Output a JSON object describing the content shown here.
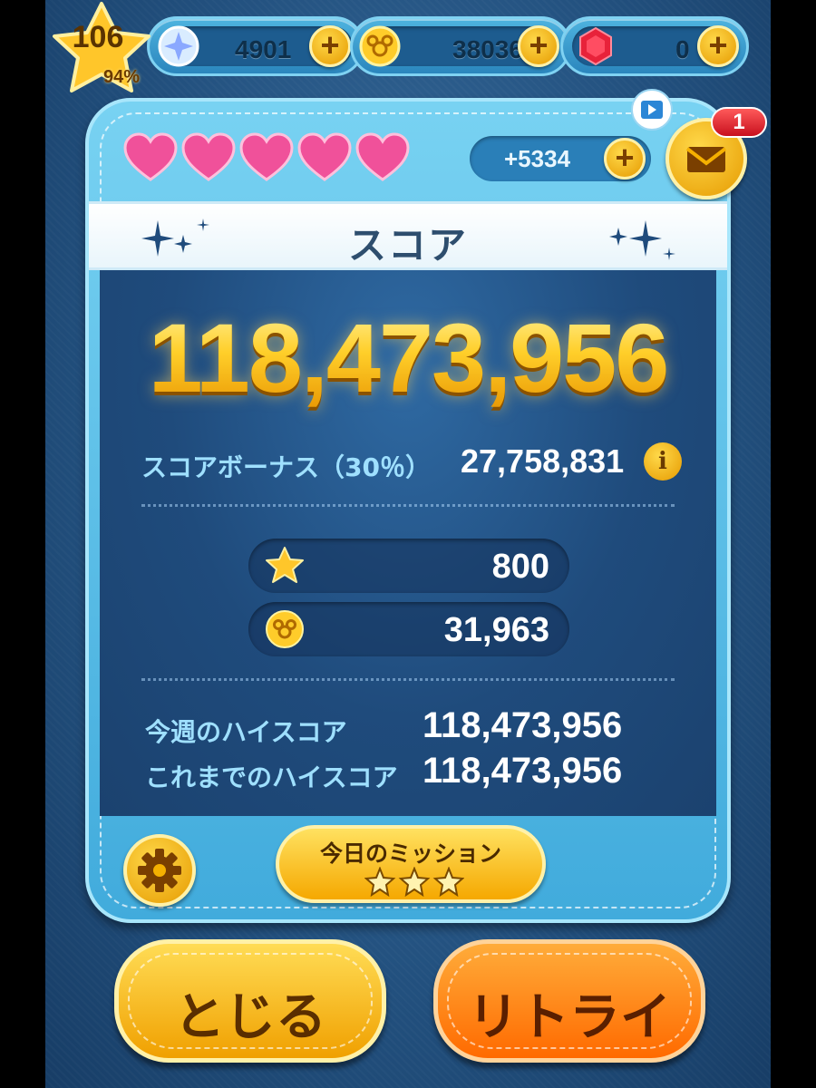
{
  "player": {
    "level": "106",
    "level_progress": "94%"
  },
  "resources": {
    "gems": {
      "value": "4901",
      "icon": "crystal-icon"
    },
    "coins": {
      "value": "38036",
      "icon": "coin-icon"
    },
    "rubies": {
      "value": "0",
      "icon": "ruby-icon"
    }
  },
  "lives": {
    "hearts": 5,
    "bonus": "+5334"
  },
  "mail": {
    "badge": "1"
  },
  "result": {
    "title": "スコア",
    "score": "118,473,956",
    "bonus_label": "スコアボーナス（30％）",
    "bonus_value": "27,758,831",
    "stars_earned": "800",
    "coins_earned": "31,963",
    "weekly_high_label": "今週のハイスコア",
    "weekly_high_value": "118,473,956",
    "alltime_high_label": "これまでのハイスコア",
    "alltime_high_value": "118,473,956"
  },
  "mission": {
    "label": "今日のミッション",
    "stars": 3
  },
  "buttons": {
    "close": "とじる",
    "retry": "リトライ"
  },
  "colors": {
    "gold": "#ffc21e",
    "panel_blue": "#41abdc",
    "score_bg": "#1f4b7c",
    "label_blue": "#9fe0ff"
  }
}
